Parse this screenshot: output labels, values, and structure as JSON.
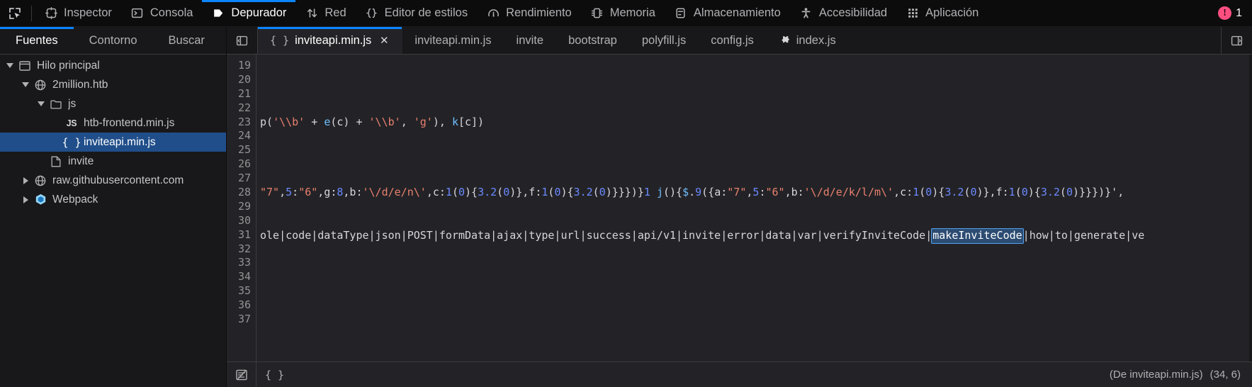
{
  "toolbar": {
    "picker_icon": "element-picker-icon",
    "tools": [
      {
        "label": "Inspector",
        "icon": "inspector-icon",
        "selected": false
      },
      {
        "label": "Consola",
        "icon": "console-icon",
        "selected": false
      },
      {
        "label": "Depurador",
        "icon": "debugger-icon",
        "selected": true
      },
      {
        "label": "Red",
        "icon": "network-icon",
        "selected": false
      },
      {
        "label": "Editor de estilos",
        "icon": "style-editor-icon",
        "selected": false
      },
      {
        "label": "Rendimiento",
        "icon": "performance-icon",
        "selected": false
      },
      {
        "label": "Memoria",
        "icon": "memory-icon",
        "selected": false
      },
      {
        "label": "Almacenamiento",
        "icon": "storage-icon",
        "selected": false
      },
      {
        "label": "Accesibilidad",
        "icon": "accessibility-icon",
        "selected": false
      },
      {
        "label": "Aplicación",
        "icon": "application-icon",
        "selected": false
      }
    ],
    "error_count": "1",
    "error_color": "#ff4f81",
    "accent_color": "#0a84ff"
  },
  "left_panel": {
    "tabs": [
      {
        "label": "Fuentes",
        "selected": true
      },
      {
        "label": "Contorno",
        "selected": false
      },
      {
        "label": "Buscar",
        "selected": false
      }
    ],
    "tree": [
      {
        "label": "Hilo principal",
        "icon": "window-icon",
        "depth": 0,
        "twisty": "open",
        "selected": false
      },
      {
        "label": "2million.htb",
        "icon": "globe-icon",
        "depth": 1,
        "twisty": "open",
        "selected": false
      },
      {
        "label": "js",
        "icon": "folder-icon",
        "depth": 2,
        "twisty": "open",
        "selected": false
      },
      {
        "label": "htb-frontend.min.js",
        "icon": "js-file-icon",
        "depth": 3,
        "twisty": "none",
        "selected": false
      },
      {
        "label": "inviteapi.min.js",
        "icon": "brace-file-icon",
        "depth": 3,
        "twisty": "none",
        "selected": true
      },
      {
        "label": "invite",
        "icon": "document-icon",
        "depth": 2,
        "twisty": "none",
        "selected": false
      },
      {
        "label": "raw.githubusercontent.com",
        "icon": "globe-icon",
        "depth": 1,
        "twisty": "closed",
        "selected": false
      },
      {
        "label": "Webpack",
        "icon": "webpack-icon",
        "depth": 1,
        "twisty": "closed",
        "selected": false
      }
    ]
  },
  "source_tabs": {
    "collapse_icon": "collapse-panel-icon",
    "expand_icon": "expand-panel-icon",
    "items": [
      {
        "label": "inviteapi.min.js",
        "icon": "brace-file-icon",
        "active": true,
        "closable": true
      },
      {
        "label": "inviteapi.min.js",
        "icon": "none",
        "active": false,
        "closable": false
      },
      {
        "label": "invite",
        "icon": "none",
        "active": false,
        "closable": false
      },
      {
        "label": "bootstrap",
        "icon": "none",
        "active": false,
        "closable": false
      },
      {
        "label": "polyfill.js",
        "icon": "none",
        "active": false,
        "closable": false
      },
      {
        "label": "config.js",
        "icon": "none",
        "active": false,
        "closable": false
      },
      {
        "label": "index.js",
        "icon": "puzzle-icon",
        "active": false,
        "closable": false
      }
    ],
    "close_label": "✕"
  },
  "editor": {
    "first_line": 19,
    "last_line": 37,
    "lines": [
      {
        "n": 19,
        "segments": []
      },
      {
        "n": 20,
        "segments": []
      },
      {
        "n": 21,
        "segments": []
      },
      {
        "n": 22,
        "segments": []
      },
      {
        "n": 23,
        "segments": [
          {
            "t": "p(",
            "c": "pun"
          },
          {
            "t": "'\\\\b'",
            "c": "str"
          },
          {
            "t": " + ",
            "c": "pun"
          },
          {
            "t": "e",
            "c": "fn"
          },
          {
            "t": "(c) + ",
            "c": "pun"
          },
          {
            "t": "'\\\\b'",
            "c": "str"
          },
          {
            "t": ", ",
            "c": "pun"
          },
          {
            "t": "'g'",
            "c": "str"
          },
          {
            "t": "), ",
            "c": "pun"
          },
          {
            "t": "k",
            "c": "fn"
          },
          {
            "t": "[c])",
            "c": "pun"
          }
        ]
      },
      {
        "n": 24,
        "segments": []
      },
      {
        "n": 25,
        "segments": []
      },
      {
        "n": 26,
        "segments": []
      },
      {
        "n": 27,
        "segments": []
      },
      {
        "n": 28,
        "segments": [
          {
            "t": "\"7\"",
            "c": "str"
          },
          {
            "t": ",",
            "c": "pun"
          },
          {
            "t": "5",
            "c": "num"
          },
          {
            "t": ":",
            "c": "pun"
          },
          {
            "t": "\"6\"",
            "c": "str"
          },
          {
            "t": ",g:",
            "c": "pun"
          },
          {
            "t": "8",
            "c": "num"
          },
          {
            "t": ",b:",
            "c": "pun"
          },
          {
            "t": "'\\/d/e/n\\'",
            "c": "str"
          },
          {
            "t": ",c:",
            "c": "pun"
          },
          {
            "t": "1",
            "c": "num"
          },
          {
            "t": "(",
            "c": "pun"
          },
          {
            "t": "0",
            "c": "num"
          },
          {
            "t": "){",
            "c": "pun"
          },
          {
            "t": "3.2",
            "c": "num"
          },
          {
            "t": "(",
            "c": "pun"
          },
          {
            "t": "0",
            "c": "num"
          },
          {
            "t": ")},f:",
            "c": "pun"
          },
          {
            "t": "1",
            "c": "num"
          },
          {
            "t": "(",
            "c": "pun"
          },
          {
            "t": "0",
            "c": "num"
          },
          {
            "t": "){",
            "c": "pun"
          },
          {
            "t": "3.2",
            "c": "num"
          },
          {
            "t": "(",
            "c": "pun"
          },
          {
            "t": "0",
            "c": "num"
          },
          {
            "t": ")}}})}",
            "c": "pun"
          },
          {
            "t": "1",
            "c": "num"
          },
          {
            "t": " ",
            "c": "pun"
          },
          {
            "t": "j",
            "c": "fn"
          },
          {
            "t": "(){",
            "c": "pun"
          },
          {
            "t": "$",
            "c": "fn"
          },
          {
            "t": ".",
            "c": "pun"
          },
          {
            "t": "9",
            "c": "num"
          },
          {
            "t": "({a:",
            "c": "pun"
          },
          {
            "t": "\"7\"",
            "c": "str"
          },
          {
            "t": ",",
            "c": "pun"
          },
          {
            "t": "5",
            "c": "num"
          },
          {
            "t": ":",
            "c": "pun"
          },
          {
            "t": "\"6\"",
            "c": "str"
          },
          {
            "t": ",b:",
            "c": "pun"
          },
          {
            "t": "'\\/d/e/k/l/m\\'",
            "c": "str"
          },
          {
            "t": ",c:",
            "c": "pun"
          },
          {
            "t": "1",
            "c": "num"
          },
          {
            "t": "(",
            "c": "pun"
          },
          {
            "t": "0",
            "c": "num"
          },
          {
            "t": "){",
            "c": "pun"
          },
          {
            "t": "3.2",
            "c": "num"
          },
          {
            "t": "(",
            "c": "pun"
          },
          {
            "t": "0",
            "c": "num"
          },
          {
            "t": ")},f:",
            "c": "pun"
          },
          {
            "t": "1",
            "c": "num"
          },
          {
            "t": "(",
            "c": "pun"
          },
          {
            "t": "0",
            "c": "num"
          },
          {
            "t": "){",
            "c": "pun"
          },
          {
            "t": "3.2",
            "c": "num"
          },
          {
            "t": "(",
            "c": "pun"
          },
          {
            "t": "0",
            "c": "num"
          },
          {
            "t": ")}}})}'",
            "c": "pun"
          },
          {
            "t": ",",
            "c": "pun"
          }
        ]
      },
      {
        "n": 29,
        "segments": []
      },
      {
        "n": 30,
        "segments": []
      },
      {
        "n": 31,
        "segments": [
          {
            "t": "ole|code|dataType|json|POST|formData|ajax|type|url|success|api/v1|invite|error|data|var|verifyInviteCode",
            "c": "pun"
          },
          {
            "t": "|",
            "c": "pun"
          },
          {
            "t": "makeInviteCode",
            "c": "match"
          },
          {
            "t": "|how|to|generate|ve",
            "c": "pun"
          }
        ]
      },
      {
        "n": 32,
        "segments": []
      },
      {
        "n": 33,
        "segments": []
      },
      {
        "n": 34,
        "segments": []
      },
      {
        "n": 35,
        "segments": []
      },
      {
        "n": 36,
        "segments": []
      },
      {
        "n": 37,
        "segments": []
      }
    ],
    "search_match": "makeInviteCode",
    "match_border_color": "#53a0f0",
    "match_bg_color": "#2c4c72"
  },
  "status_bar": {
    "pretty_print_icon": "pretty-print-icon",
    "brace_label": "{ }",
    "origin": "(De inviteapi.min.js)",
    "position": "(34, 6)"
  }
}
